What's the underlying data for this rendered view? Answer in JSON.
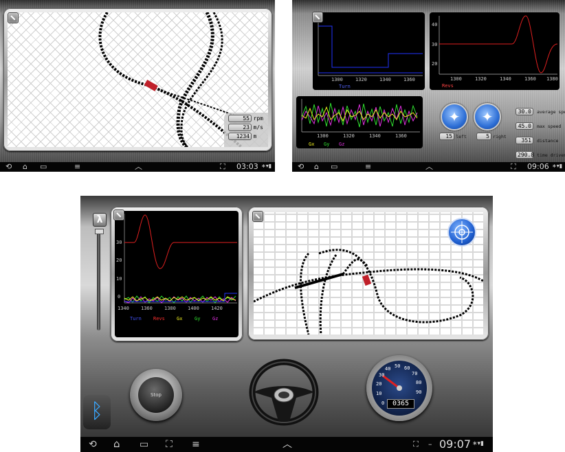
{
  "shot1": {
    "readouts": [
      {
        "value": "55",
        "unit": "rpm"
      },
      {
        "value": "23",
        "unit": "m/s"
      },
      {
        "value": "1234",
        "unit": "m"
      }
    ],
    "clock": "03:03"
  },
  "shot2": {
    "chart_top_left": {
      "x_ticks": [
        "1300",
        "1320",
        "1340",
        "1360"
      ],
      "legend": "Turn"
    },
    "chart_top_right": {
      "x_ticks": [
        "1300",
        "1320",
        "1340",
        "1360",
        "1380"
      ],
      "y_ticks": [
        "40",
        "30",
        "20"
      ],
      "legend": "Revs"
    },
    "chart_bottom": {
      "x_ticks": [
        "1300",
        "1320",
        "1340",
        "1360"
      ],
      "legend": [
        "Gx",
        "Gy",
        "Gz"
      ]
    },
    "compass_left": {
      "value": "15",
      "label": "left"
    },
    "compass_right": {
      "value": "5",
      "label": "right"
    },
    "stats": [
      {
        "value": "30.0",
        "label": "average speed"
      },
      {
        "value": "45.0",
        "label": "max speed"
      },
      {
        "value": "351",
        "label": "distance"
      },
      {
        "value": "290.8",
        "label": "time driven"
      }
    ],
    "clock": "09:06"
  },
  "shot3": {
    "lambda_label": "λ",
    "chart": {
      "y_ticks": [
        "30",
        "20",
        "10",
        "0"
      ],
      "x_ticks": [
        "1340",
        "1360",
        "1380",
        "1400",
        "1420"
      ],
      "legend": [
        "Turn",
        "Revs",
        "Gx",
        "Gy",
        "Gz"
      ],
      "legend_colors": [
        "#2233ff",
        "#ff2020",
        "#f0f020",
        "#30e030",
        "#e030e0"
      ]
    },
    "stop_label": "Stop",
    "odometer": "0365",
    "speedo_ticks": [
      "0",
      "10",
      "20",
      "30",
      "40",
      "50",
      "60",
      "70",
      "80",
      "90"
    ],
    "clock": "09:07"
  }
}
